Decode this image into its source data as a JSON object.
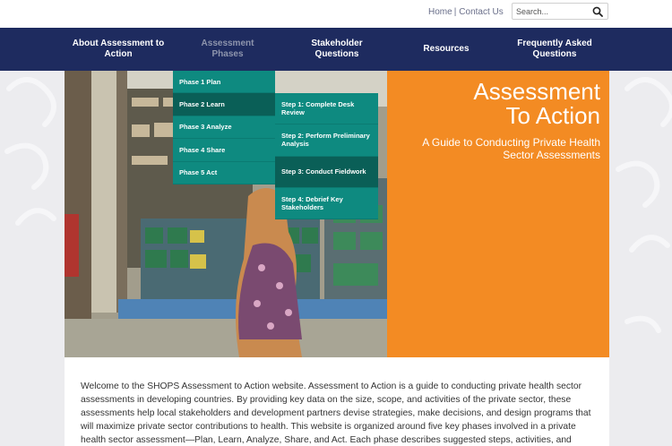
{
  "utility": {
    "home_label": "Home",
    "separator": "|",
    "contact_label": "Contact Us"
  },
  "search": {
    "placeholder": "Search...",
    "icon": "magnifier-icon"
  },
  "nav": {
    "items": [
      {
        "label": "About Assessment to Action"
      },
      {
        "label": "Assessment Phases"
      },
      {
        "label": "Stakeholder Questions"
      },
      {
        "label": "Resources"
      },
      {
        "label": "Frequently Asked Questions"
      }
    ],
    "active_index": 1
  },
  "phases_menu": {
    "items": [
      {
        "label": "Phase 1 Plan"
      },
      {
        "label": "Phase 2 Learn"
      },
      {
        "label": "Phase 3 Analyze"
      },
      {
        "label": "Phase 4 Share"
      },
      {
        "label": "Phase 5 Act"
      }
    ]
  },
  "steps_menu": {
    "items": [
      {
        "label": "Step 1: Complete Desk Review"
      },
      {
        "label": "Step 2: Perform Preliminary Analysis"
      },
      {
        "label": "Step 3: Conduct Fieldwork"
      },
      {
        "label": "Step 4: Debrief Key Stakeholders"
      }
    ]
  },
  "hero": {
    "title_line1": "Assessment",
    "title_line2": "To Action",
    "subtitle": "A Guide to Conducting Private Health Sector Assessments"
  },
  "intro": {
    "text": "Welcome to the SHOPS Assessment to Action website. Assessment to Action is a guide to conducting private health sector assessments in developing countries. By providing key data on the size, scope, and activities of the private sector, these assessments help local stakeholders and development partners devise strategies, make decisions, and design programs that will maximize private sector contributions to health. This website is organized around five key phases involved in a private health sector assessment—Plan, Learn, Analyze, Share, and Act. Each phase describes suggested steps, activities, and"
  },
  "colors": {
    "nav_bg": "#1e2b5f",
    "hero_orange": "#f38b23",
    "menu_teal": "#0e8a80",
    "menu_teal_active": "#0a5f57"
  }
}
